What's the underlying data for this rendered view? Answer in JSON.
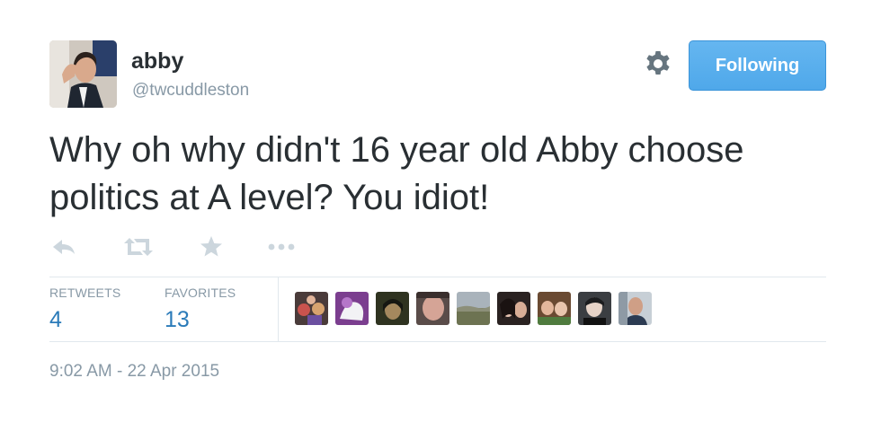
{
  "user": {
    "name": "abby",
    "handle": "@twcuddleston",
    "avatar_icon": "profile-photo"
  },
  "header": {
    "settings_icon": "gear-icon",
    "follow_button_label": "Following",
    "follow_button_color": "#55acee"
  },
  "tweet": {
    "text": "Why oh why didn't 16 year old Abby choose politics at A level? You idiot!"
  },
  "actions": [
    {
      "name": "reply",
      "icon": "reply-icon"
    },
    {
      "name": "retweet",
      "icon": "retweet-icon"
    },
    {
      "name": "favorite",
      "icon": "star-icon"
    },
    {
      "name": "more",
      "icon": "more-icon"
    }
  ],
  "stats": {
    "retweets_label": "RETWEETS",
    "retweets_count": "4",
    "favorites_label": "FAVORITES",
    "favorites_count": "13"
  },
  "favoriter_avatar_count": 9,
  "timestamp": "9:02 AM - 22 Apr 2015",
  "colors": {
    "link": "#2b7bb9",
    "muted": "#8899a6",
    "text": "#292f33",
    "divider": "#e1e8ed"
  }
}
